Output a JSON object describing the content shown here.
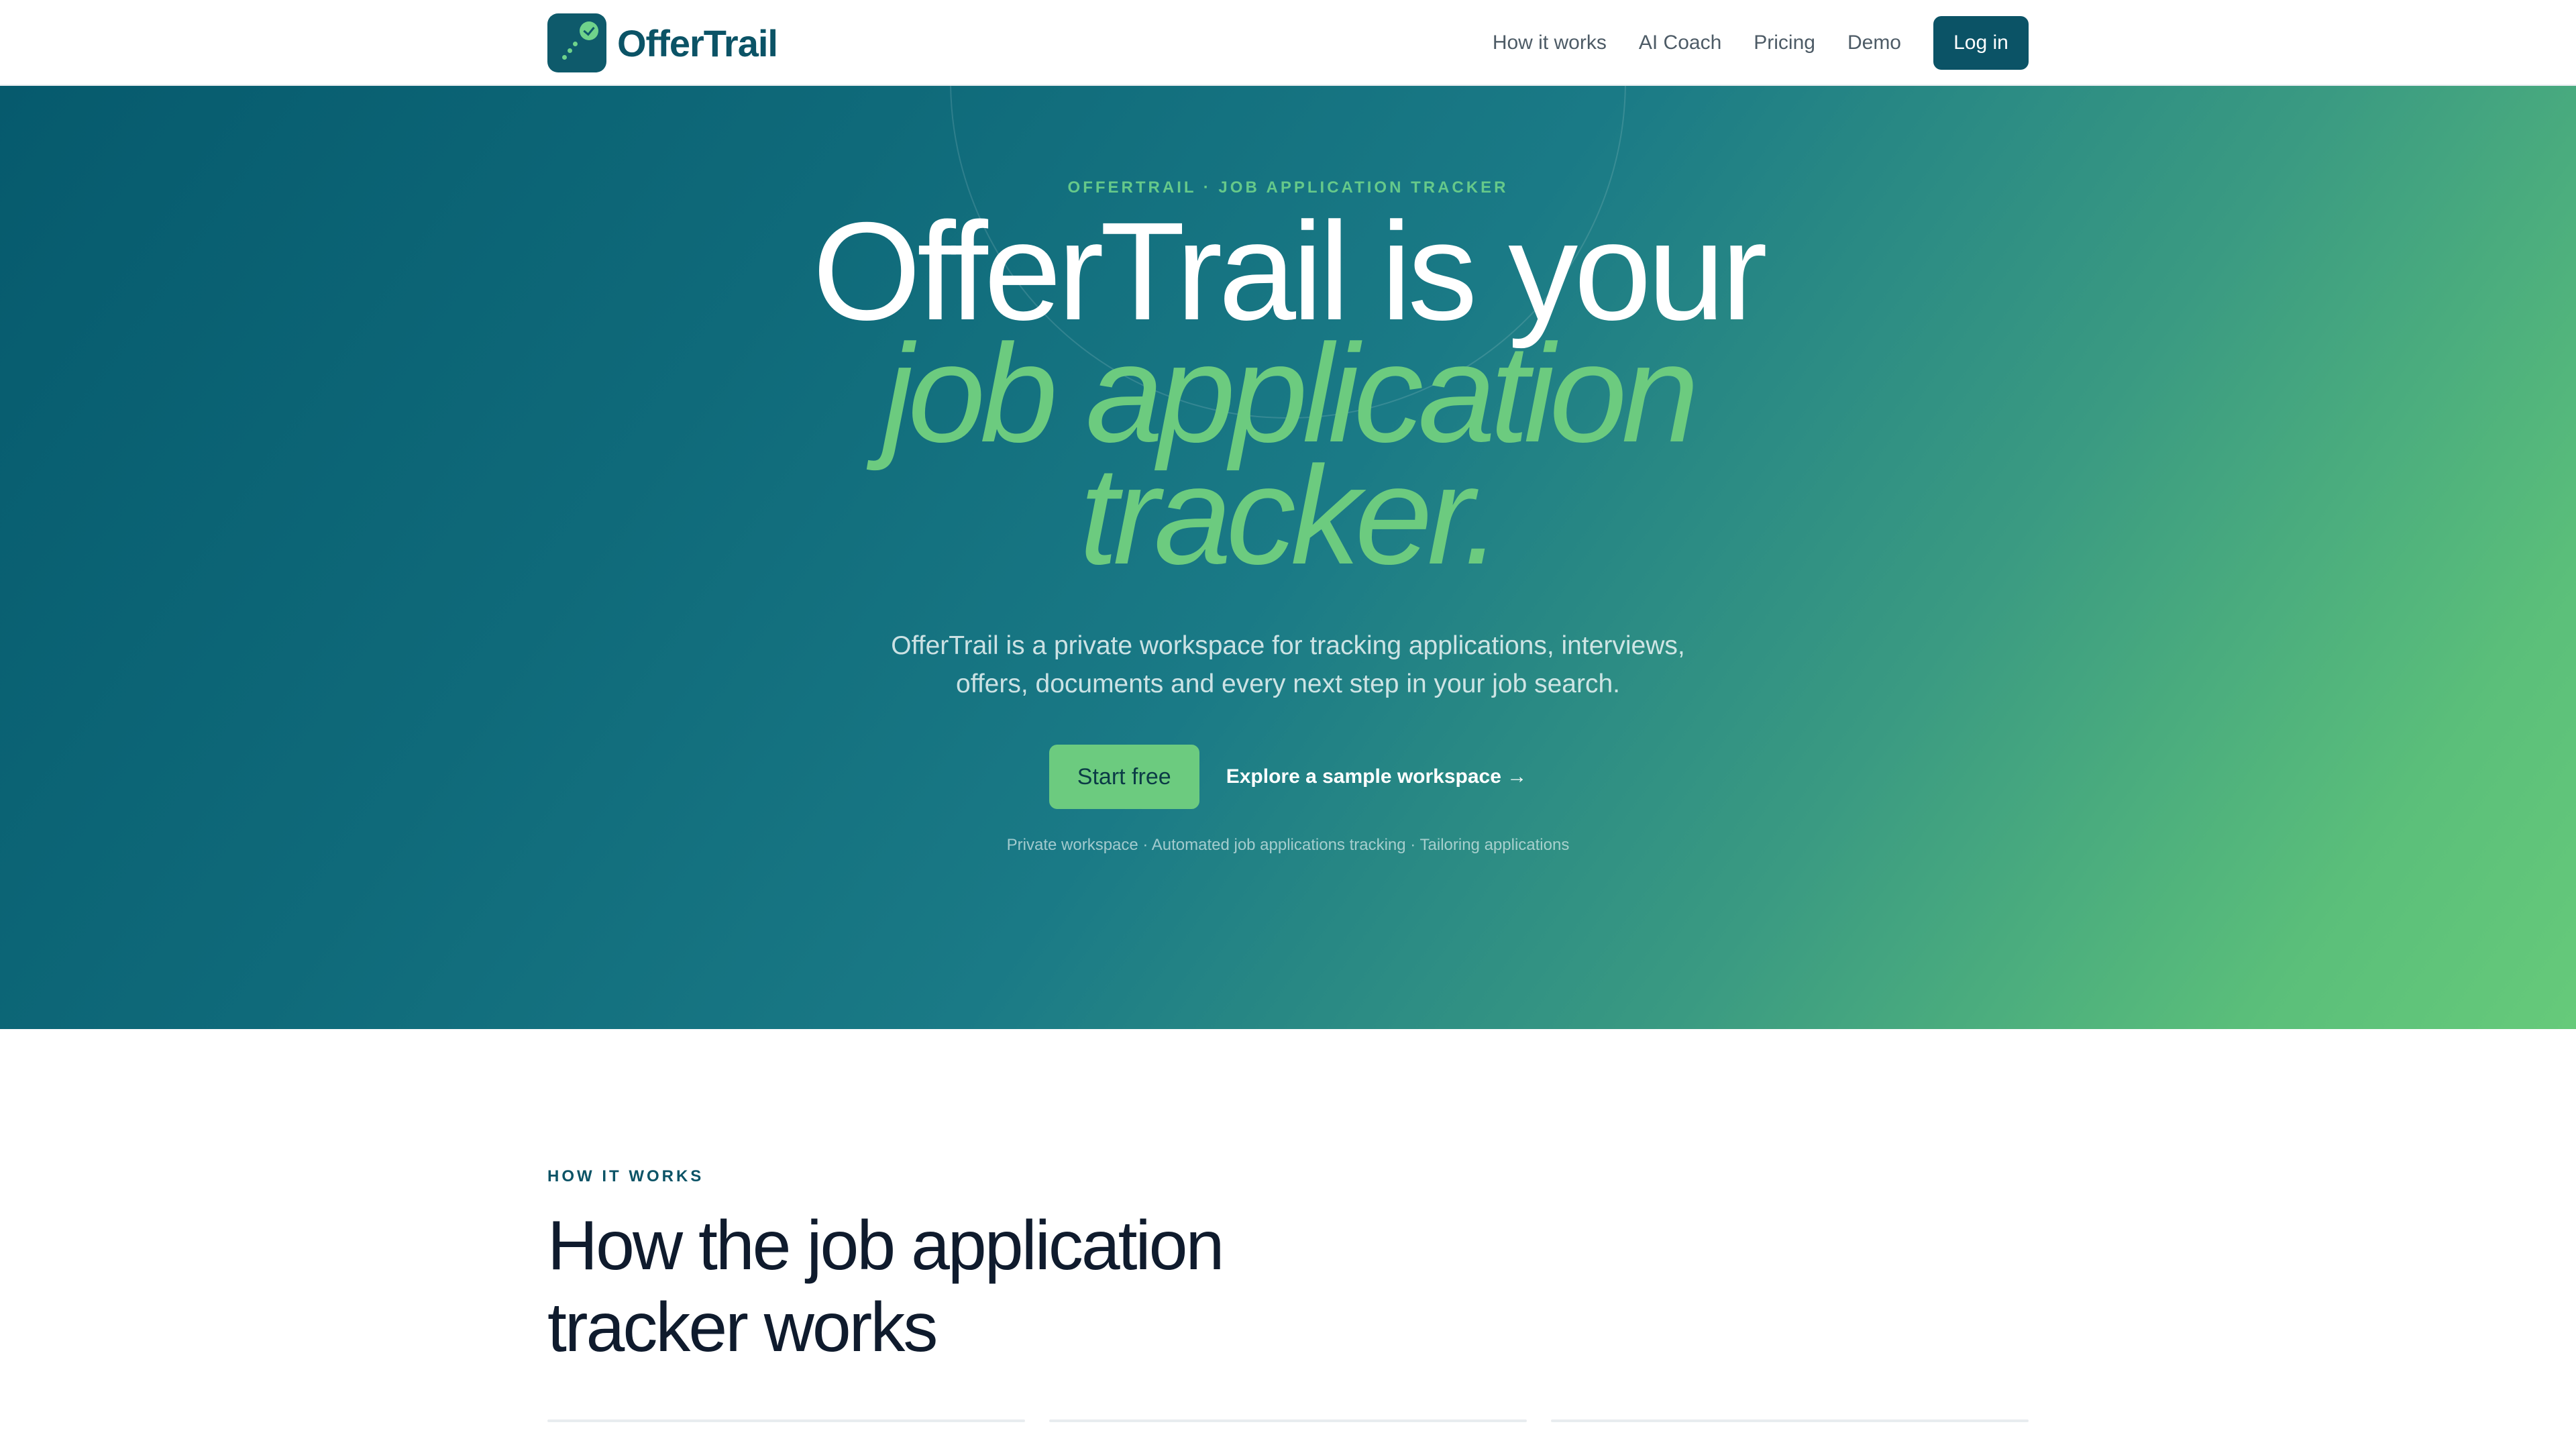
{
  "nav": {
    "brand_name": "OfferTrail",
    "links": [
      "How it works",
      "AI Coach",
      "Pricing",
      "Demo"
    ],
    "login_label": "Log in"
  },
  "hero": {
    "eyebrow": "OFFERTRAIL · JOB APPLICATION TRACKER",
    "title_line1": "OfferTrail is your",
    "title_accent_line1": "job application",
    "title_accent_line2": "tracker.",
    "subtitle": "OfferTrail is a private workspace for tracking applications, interviews, offers, documents and every next step in your job search.",
    "cta_primary": "Start free",
    "cta_secondary": "Explore a sample workspace →",
    "features": "Private workspace · Automated job applications tracking · Tailoring applications"
  },
  "how_it_works": {
    "eyebrow": "HOW IT WORKS",
    "title": "How the job application tracker works"
  },
  "colors": {
    "brand": "#0b5366",
    "accent": "#6ccb7f",
    "heading": "#0f1b2d"
  }
}
